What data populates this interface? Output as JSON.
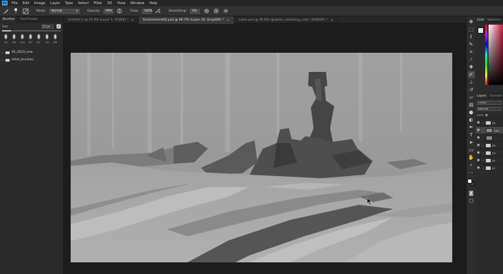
{
  "app": {
    "logo": "Ps"
  },
  "menu": [
    "File",
    "Edit",
    "Image",
    "Layer",
    "Type",
    "Select",
    "Filter",
    "3D",
    "View",
    "Window",
    "Help"
  ],
  "options": {
    "brush_size": "3",
    "mode_label": "Mode:",
    "mode_value": "Normal",
    "opacity_label": "Opacity:",
    "opacity_value": "99%",
    "flow_label": "Flow:",
    "flow_value": "100%",
    "smoothing_label": "Smoothing:",
    "smoothing_value": "0%"
  },
  "brushes_panel": {
    "tabs": [
      "Brushes",
      "Tool Presets"
    ],
    "size_label": "Size",
    "size_value": "25 px",
    "size_fraction": 0.15,
    "presets": [
      "25",
      "39",
      "112",
      "87",
      "87",
      "43",
      "69"
    ],
    "folders": [
      "SK_2019_new",
      "Artist_brushes"
    ]
  },
  "document_tabs": [
    {
      "label": "Untitled-1 @ 42.6% (Layer 1, RGB/8) *",
      "active": false
    },
    {
      "label": "Environment02.psd @ 66.7% (Layer 16, Gray/8#) *",
      "active": true
    },
    {
      "label": "notes.psd @ 36.9% (graphic_sketching_color, RGB/8#) *",
      "active": false
    }
  ],
  "right_panel": {
    "top_tabs": [
      "Color",
      "Swatches"
    ],
    "layers_tabs": [
      "Layers",
      "Channels"
    ],
    "kind_value": "Kind",
    "blend_value": "Normal",
    "lock_label": "Lock:",
    "layers": [
      {
        "name": "04",
        "type": "folder",
        "active": false
      },
      {
        "name": "Lay...",
        "type": "layer",
        "active": true
      },
      {
        "name": "",
        "type": "layer",
        "active": false
      },
      {
        "name": "05",
        "type": "folder",
        "active": false
      },
      {
        "name": "03",
        "type": "folder",
        "active": false
      },
      {
        "name": "02",
        "type": "folder",
        "active": false
      },
      {
        "name": "01",
        "type": "folder",
        "active": false
      }
    ]
  },
  "colors": {
    "ui_dark": "#1e1e1e",
    "panel": "#2b2b2b",
    "canvas_sky": "#9a9a9a",
    "canvas_ground": "#a9a9a9",
    "accent": "#31a8ff"
  },
  "icons": {
    "tools": [
      "move-icon",
      "marquee-icon",
      "lasso-icon",
      "quick-select-icon",
      "crop-icon",
      "eyedropper-icon",
      "healing-icon",
      "brush-icon",
      "stamp-icon",
      "history-brush-icon",
      "eraser-icon",
      "gradient-icon",
      "blur-icon",
      "dodge-icon",
      "pen-icon",
      "type-icon",
      "path-select-icon",
      "shape-icon",
      "hand-icon",
      "zoom-icon",
      "more-icon"
    ]
  }
}
